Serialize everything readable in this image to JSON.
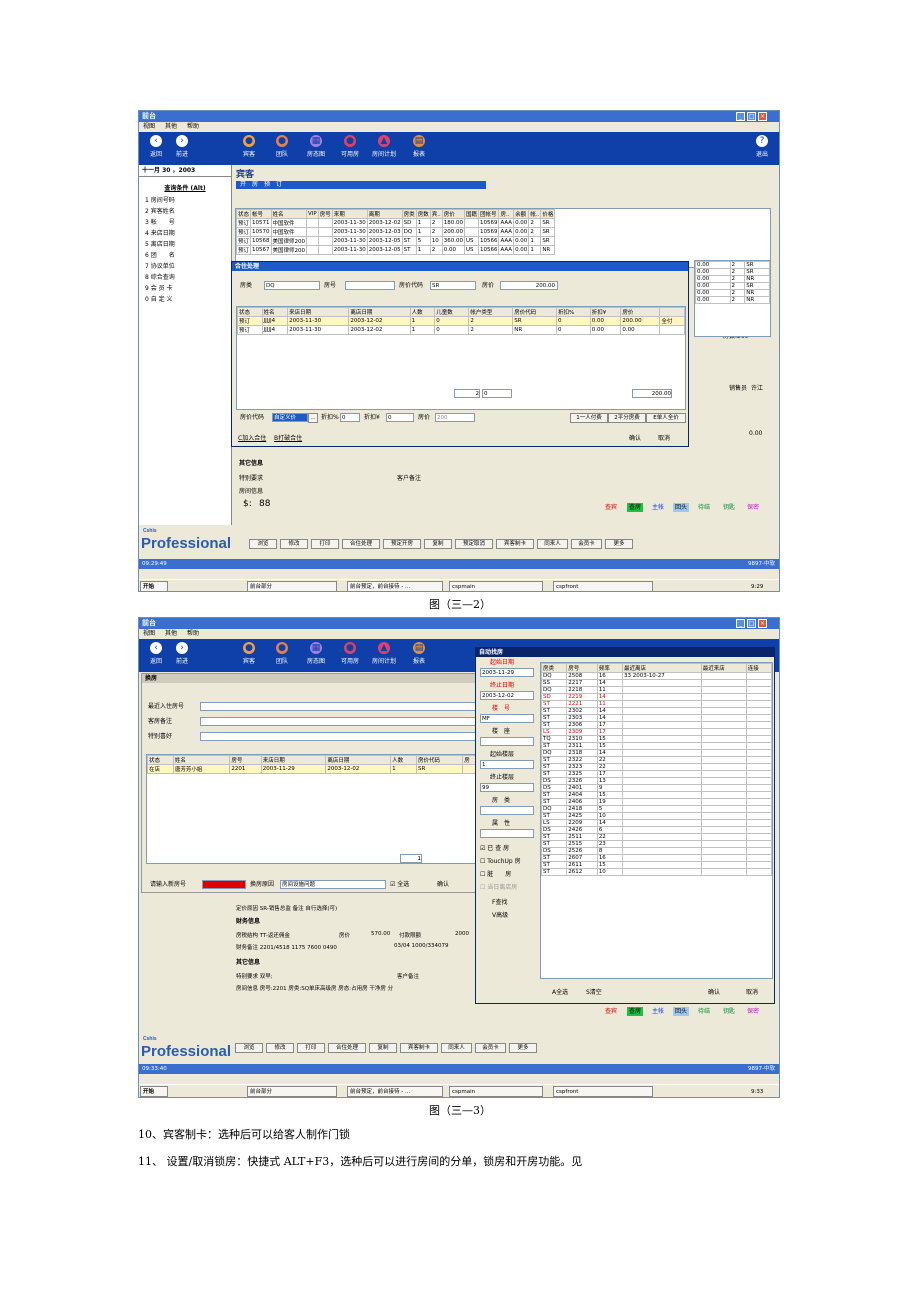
{
  "s1": {
    "title": "前台",
    "menu": [
      "视图",
      "其他",
      "帮助"
    ],
    "toolbar": [
      "返回",
      "前进",
      "宾客",
      "团队",
      "房态图",
      "可用房",
      "房间计划",
      "报表",
      "退出"
    ],
    "date": "十一月 30 ，2003",
    "side_head": "查询条件 (Alt)",
    "side_items": [
      "1 房间号码",
      "2 宾客姓名",
      "3 帐　　号",
      "4 来店日期",
      "5 离店日期",
      "6 团　　名",
      "7 协议单位",
      "8 综合查询",
      "9 会 员 卡",
      "0 自 定 义"
    ],
    "panel_title": "宾客",
    "tabs": "开　房　预　订",
    "grid_head": [
      "状态",
      "帐号",
      "姓名",
      "VIP",
      "房号",
      "来期",
      "离期",
      "房类",
      "房数",
      "宾..",
      "房价",
      "国籍",
      "团帐号",
      "房..",
      "余额",
      "帐..",
      "价格"
    ],
    "grid_rows": [
      [
        "预订",
        "10571",
        "中国软件",
        "",
        "",
        "2003-11-30",
        "2003-12-02",
        "SD",
        "1",
        "2",
        "180.00",
        "",
        "10569",
        "AAA",
        "0.00",
        "2",
        "SR"
      ],
      [
        "预订",
        "10570",
        "中国软件",
        "",
        "",
        "2003-11-30",
        "2003-12-03",
        "DQ",
        "1",
        "2",
        "200.00",
        "",
        "10569",
        "AAA",
        "0.00",
        "2",
        "SR"
      ],
      [
        "预订",
        "10568",
        "美国律师200",
        "",
        "",
        "2003-11-30",
        "2003-12-05",
        "ST",
        "5",
        "10",
        "360.00",
        "US",
        "10566",
        "AAA",
        "0.00",
        "1",
        "SR"
      ],
      [
        "预订",
        "10567",
        "美国律师200",
        "",
        "",
        "2003-11-30",
        "2003-12-05",
        "ST",
        "1",
        "2",
        "0.00",
        "US",
        "10566",
        "AAA",
        "0.00",
        "1",
        "NR"
      ]
    ],
    "right_col": [
      [
        "0.00",
        "2",
        "SR"
      ],
      [
        "0.00",
        "2",
        "SR"
      ],
      [
        "0.00",
        "2",
        "NR"
      ],
      [
        "0.00",
        "2",
        "SR"
      ],
      [
        "0.00",
        "2",
        "NR"
      ],
      [
        "0.00",
        "2",
        "NR"
      ]
    ],
    "count_label": "房数:269",
    "sales_label": "销售员",
    "sales_value": "许江",
    "amount": "0.00",
    "dialog": {
      "title": "合住处理",
      "room_type_label": "房类",
      "room_type": "DQ",
      "room_no_label": "房号",
      "room_no": "",
      "rate_code_label": "房价代码",
      "rate_code": "SR",
      "rate_label": "房价",
      "rate": "200.00",
      "grid_head": [
        "状态",
        "姓名",
        "来店日期",
        "离店日期",
        "人数",
        "儿童数",
        "帐户类型",
        "房价代码",
        "折扣%",
        "折扣¥",
        "房价",
        ""
      ],
      "grid_rows": [
        [
          "预订",
          "JJJJJ4",
          "2003-11-30",
          "2003-12-02",
          "1",
          "0",
          "2",
          "SR",
          "0",
          "0.00",
          "200.00",
          "全付"
        ],
        [
          "预订",
          "JJJJJ4",
          "2003-11-30",
          "2003-12-02",
          "1",
          "0",
          "2",
          "NR",
          "0",
          "0.00",
          "0.00",
          ""
        ]
      ],
      "foot_count": "2",
      "foot_zero": "0",
      "foot_total": "200.00",
      "rc_label": "房价代码",
      "rc_value": "自定义价",
      "disc_pct_label": "折扣%",
      "disc_pct": "0",
      "disc_amt_label": "折扣¥",
      "disc_amt": "0",
      "price_label": "房价",
      "price": "200",
      "btn1": "1一人付费",
      "btn2": "2平分房费",
      "btn3": "E单人全价",
      "add": "C加入合住",
      "break": "B打破合住",
      "ok": "确认",
      "cancel": "取消"
    },
    "other_title": "其它信息",
    "special_label": "特别要求",
    "remark_label": "客户备注",
    "roominfo_label": "房间信息",
    "status_tags": [
      "查宾",
      "查房",
      "主帐",
      "回头",
      "待结",
      "钥匙",
      "保密"
    ],
    "bottom_btns": [
      "浏览",
      "修改",
      "打印",
      "合住处理",
      "预定开房",
      "复制",
      "预定取消",
      "宾客制卡",
      "同来人",
      "会员卡",
      "更多"
    ],
    "brand_small": "Cshis",
    "brand": "Professional",
    "time": "09:29:49",
    "ver": "9897-中软",
    "taskbar": [
      "开始",
      "前台部分",
      "前台预定，前台接待 - ...",
      "cspmain",
      "cspfront"
    ],
    "clock": "9:29"
  },
  "cap1": "图（三—2）",
  "s2": {
    "title": "前台",
    "menu": [
      "视图",
      "其他",
      "帮助"
    ],
    "toolbar": [
      "返回",
      "前进",
      "宾客",
      "团队",
      "房态图",
      "可用房",
      "房间计划",
      "报表"
    ],
    "change_title": "换房",
    "recent_label": "最近入住房号",
    "guest_remark_label": "客房备注",
    "special_pref_label": "特别喜好",
    "grid_head": [
      "状态",
      "姓名",
      "房号",
      "来店日期",
      "离店日期",
      "人数",
      "房价代码",
      "房"
    ],
    "grid_rows": [
      [
        "在店",
        "唐芳芳小姐",
        "2201",
        "2003-11-29",
        "2003-12-02",
        "1",
        "SR",
        ""
      ]
    ],
    "count": "1",
    "new_room_label": "请输入新房号",
    "reason_label": "换房原因",
    "reason_value": "房间设施问题",
    "select_all": "全选",
    "ok": "确认",
    "fixed_reason": "定价原因 SR-销售总监 备注 自行选择(可)",
    "fin_title": "财务信息",
    "tax_label": "房税结构 TT-返还佣金",
    "price_label": "房价",
    "price_value": "570.00",
    "pay_label": "付款限额",
    "pay_value": "2000",
    "fin_note": "财务备注 2201/4518 1175 7600 0490",
    "fin_note2": "03/04 1000/334079",
    "other_title": "其它信息",
    "special_line": "特别要求 双早;",
    "remark_label": "客户备注",
    "room_info_line": "房间信息 房号:2201 房类:SQ单床高级房 房态:占用房 干净房 分",
    "status_tags": [
      "查宾",
      "查房",
      "主帐",
      "回头",
      "待结",
      "钥匙",
      "保密"
    ],
    "bottom_btns": [
      "浏览",
      "修改",
      "打印",
      "合住处理",
      "复制",
      "宾客制卡",
      "同来人",
      "会员卡",
      "更多"
    ],
    "brand_small": "Cshis",
    "brand": "Professional",
    "time": "09:33:40",
    "ver": "9897-中软",
    "taskbar": [
      "开始",
      "前台部分",
      "前台预定，前台接待 - ...",
      "cspmain",
      "cspfront"
    ],
    "clock": "9:33",
    "auto": {
      "title": "自动找房",
      "start_label": "起始日期",
      "start": "2003-11-29",
      "end_label": "终止日期",
      "end": "2003-12-02",
      "type_label": "楼　号",
      "type_val": "MF",
      "build_label": "楼　座",
      "floor_from_label": "起始楼层",
      "floor_from": "1",
      "floor_to_label": "终止楼层",
      "floor_to": "99",
      "roomtype_label": "房　类",
      "attr_label": "属　性",
      "chk1": "已 查 房",
      "chk2": "TouchUp 房",
      "chk3": "脏　　房",
      "chk4": "当日离店房",
      "find": "F查找",
      "adv": "V高级",
      "head": [
        "房类",
        "房号",
        "频率",
        "最近离店",
        "最近来店",
        "连接"
      ],
      "rows": [
        [
          "DQ",
          "2508",
          "16",
          "33 2003-10-27",
          "",
          ""
        ],
        [
          "SS",
          "2217",
          "14",
          "",
          "",
          ""
        ],
        [
          "DQ",
          "2218",
          "11",
          "",
          "",
          ""
        ],
        [
          "SD",
          "2219",
          "14",
          "",
          "",
          ""
        ],
        [
          "ST",
          "2221",
          "11",
          "",
          "",
          ""
        ],
        [
          "ST",
          "2302",
          "14",
          "",
          "",
          ""
        ],
        [
          "ST",
          "2303",
          "14",
          "",
          "",
          ""
        ],
        [
          "ST",
          "2306",
          "17",
          "",
          "",
          ""
        ],
        [
          "LS",
          "2309",
          "17",
          "",
          "",
          ""
        ],
        [
          "TQ",
          "2310",
          "15",
          "",
          "",
          ""
        ],
        [
          "ST",
          "2311",
          "15",
          "",
          "",
          ""
        ],
        [
          "DQ",
          "2318",
          "14",
          "",
          "",
          ""
        ],
        [
          "ST",
          "2322",
          "22",
          "",
          "",
          ""
        ],
        [
          "ST",
          "2323",
          "22",
          "",
          "",
          ""
        ],
        [
          "ST",
          "2325",
          "17",
          "",
          "",
          ""
        ],
        [
          "DS",
          "2326",
          "13",
          "",
          "",
          ""
        ],
        [
          "DS",
          "2401",
          "9",
          "",
          "",
          ""
        ],
        [
          "ST",
          "2404",
          "15",
          "",
          "",
          ""
        ],
        [
          "ST",
          "2406",
          "19",
          "",
          "",
          ""
        ],
        [
          "DQ",
          "2418",
          "5",
          "",
          "",
          ""
        ],
        [
          "ST",
          "2425",
          "10",
          "",
          "",
          ""
        ],
        [
          "LS",
          "2209",
          "14",
          "",
          "",
          ""
        ],
        [
          "DS",
          "2426",
          "6",
          "",
          "",
          ""
        ],
        [
          "ST",
          "2511",
          "22",
          "",
          "",
          ""
        ],
        [
          "ST",
          "2515",
          "23",
          "",
          "",
          ""
        ],
        [
          "DS",
          "2526",
          "8",
          "",
          "",
          ""
        ],
        [
          "ST",
          "2607",
          "16",
          "",
          "",
          ""
        ],
        [
          "ST",
          "2611",
          "15",
          "",
          "",
          ""
        ],
        [
          "ST",
          "2612",
          "10",
          "",
          "",
          ""
        ]
      ],
      "all": "A全选",
      "clear": "S清空",
      "ok": "确认",
      "cancel": "取消"
    }
  },
  "cap2": "图（三—3）",
  "p1": "10、宾客制卡：选种后可以给客人制作门锁",
  "p2": "11、 设置/取消锁房：快捷式 ALT+F3，选种后可以进行房间的分单，锁房和开房功能。见"
}
